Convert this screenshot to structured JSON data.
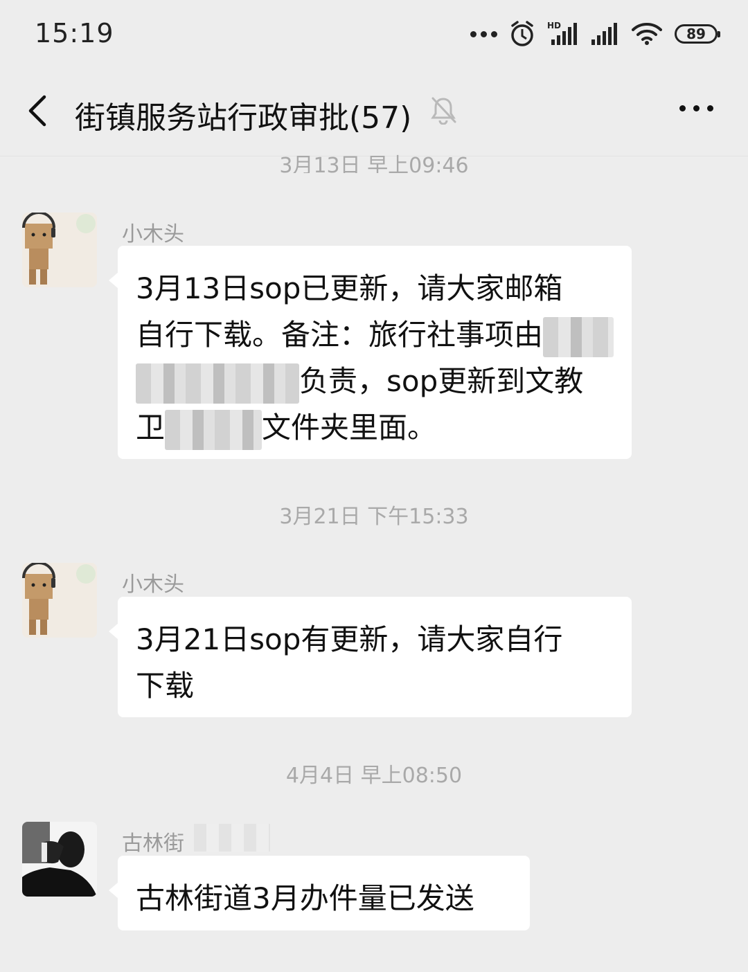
{
  "status_bar": {
    "time": "15:19",
    "battery": "89",
    "network_label": "HD"
  },
  "header": {
    "title": "街镇服务站行政审批(57)"
  },
  "messages": [
    {
      "timestamp": "3月13日 早上09:46"
    },
    {
      "sender": "小木头",
      "lines": [
        "3月13日sop已更新，请大家邮箱",
        "自行下载。备注：旅行社事项由",
        "负责，sop更新到文教",
        "卫",
        "文件夹里面。"
      ]
    },
    {
      "timestamp": "3月21日 下午15:33"
    },
    {
      "sender": "小木头",
      "lines": [
        "3月21日sop有更新，请大家自行",
        "下载"
      ]
    },
    {
      "timestamp": "4月4日 早上08:50"
    },
    {
      "sender": "古林街",
      "lines": [
        "古林街道3月办件量已发送"
      ]
    }
  ],
  "icons": [
    "signal-icon",
    "wifi-icon",
    "alarm-icon",
    "battery-icon",
    "back-icon",
    "mute-icon",
    "more-icon"
  ]
}
